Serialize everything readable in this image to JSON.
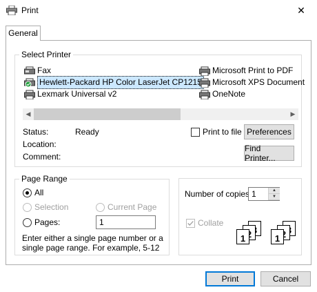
{
  "window": {
    "title": "Print",
    "close_glyph": "✕"
  },
  "tabs": [
    "General"
  ],
  "select_printer": {
    "legend": "Select Printer",
    "printers": [
      {
        "name": "Fax",
        "icon": "fax-icon"
      },
      {
        "name": "Hewlett-Packard HP Color LaserJet CP1215",
        "icon": "printer-default-icon",
        "selected": true
      },
      {
        "name": "Lexmark Universal v2",
        "icon": "printer-icon"
      },
      {
        "name": "Microsoft Print to PDF",
        "icon": "printer-icon"
      },
      {
        "name": "Microsoft XPS Document",
        "icon": "printer-icon"
      },
      {
        "name": "OneNote",
        "icon": "printer-icon"
      }
    ],
    "scroll_left": "◀",
    "scroll_right": "▶",
    "status_label": "Status:",
    "status_value": "Ready",
    "location_label": "Location:",
    "comment_label": "Comment:",
    "print_to_file_label": "Print to file",
    "preferences_button": "Preferences",
    "find_printer_button": "Find Printer..."
  },
  "page_range": {
    "legend": "Page Range",
    "all_label": "All",
    "selection_label": "Selection",
    "current_page_label": "Current Page",
    "pages_label": "Pages:",
    "pages_value": "1",
    "help_text": "Enter either a single page number or a single page range.  For example, 5-12"
  },
  "copies": {
    "number_label": "Number of copies:",
    "number_value": "1",
    "collate_label": "Collate",
    "collate_digits": [
      "1",
      "2",
      "3"
    ]
  },
  "footer": {
    "print_button": "Print",
    "cancel_button": "Cancel"
  }
}
